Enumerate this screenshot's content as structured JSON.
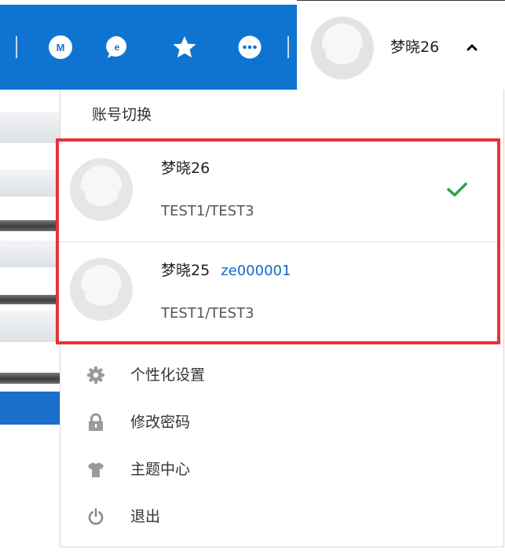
{
  "header": {
    "icons": [
      "m-icon",
      "message-icon",
      "star-icon",
      "more-icon"
    ],
    "m_glyph": "M",
    "username": "梦晓26",
    "accent_color": "#0f74d1"
  },
  "dropdown": {
    "section_title": "账号切换",
    "accounts": [
      {
        "name": "梦晓26",
        "account_id": "",
        "org": "TEST1/TEST3",
        "active": true
      },
      {
        "name": "梦晓25",
        "account_id": "ze000001",
        "org": "TEST1/TEST3",
        "active": false
      }
    ],
    "highlight_color": "#e8323a",
    "check_color": "#2ba34a",
    "menu": [
      {
        "icon": "gear-icon",
        "label": "个性化设置"
      },
      {
        "icon": "lock-icon",
        "label": "修改密码"
      },
      {
        "icon": "shirt-icon",
        "label": "主题中心"
      },
      {
        "icon": "power-icon",
        "label": "退出"
      }
    ]
  }
}
